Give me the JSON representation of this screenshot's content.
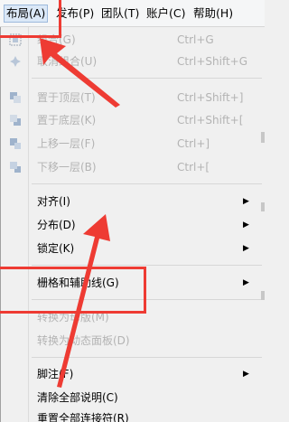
{
  "menubar": {
    "items": [
      {
        "label": "布局(A)"
      },
      {
        "label": "发布(P)"
      },
      {
        "label": "团队(T)"
      },
      {
        "label": "账户(C)"
      },
      {
        "label": "帮助(H)"
      }
    ]
  },
  "menu": {
    "group1": [
      {
        "label": "组合(G)",
        "shortcut": "Ctrl+G"
      },
      {
        "label": "取消组合(U)",
        "shortcut": "Ctrl+Shift+G"
      }
    ],
    "group2": [
      {
        "label": "置于顶层(T)",
        "shortcut": "Ctrl+Shift+]"
      },
      {
        "label": "置于底层(K)",
        "shortcut": "Ctrl+Shift+["
      },
      {
        "label": "上移一层(F)",
        "shortcut": "Ctrl+]"
      },
      {
        "label": "下移一层(B)",
        "shortcut": "Ctrl+["
      }
    ],
    "group3": [
      {
        "label": "对齐(I)"
      },
      {
        "label": "分布(D)"
      },
      {
        "label": "锁定(K)"
      }
    ],
    "group4": [
      {
        "label": "栅格和辅助线(G)"
      }
    ],
    "group5": [
      {
        "label": "转换为母版(M)"
      },
      {
        "label": "转换为动态面板(D)"
      }
    ],
    "group6": [
      {
        "label": "脚注(F)"
      },
      {
        "label": "清除全部说明(C)"
      },
      {
        "label": "重置全部连接符(R)"
      }
    ]
  },
  "colors": {
    "annotation": "#ee3b33",
    "disabled_text": "#b3b3b3"
  }
}
